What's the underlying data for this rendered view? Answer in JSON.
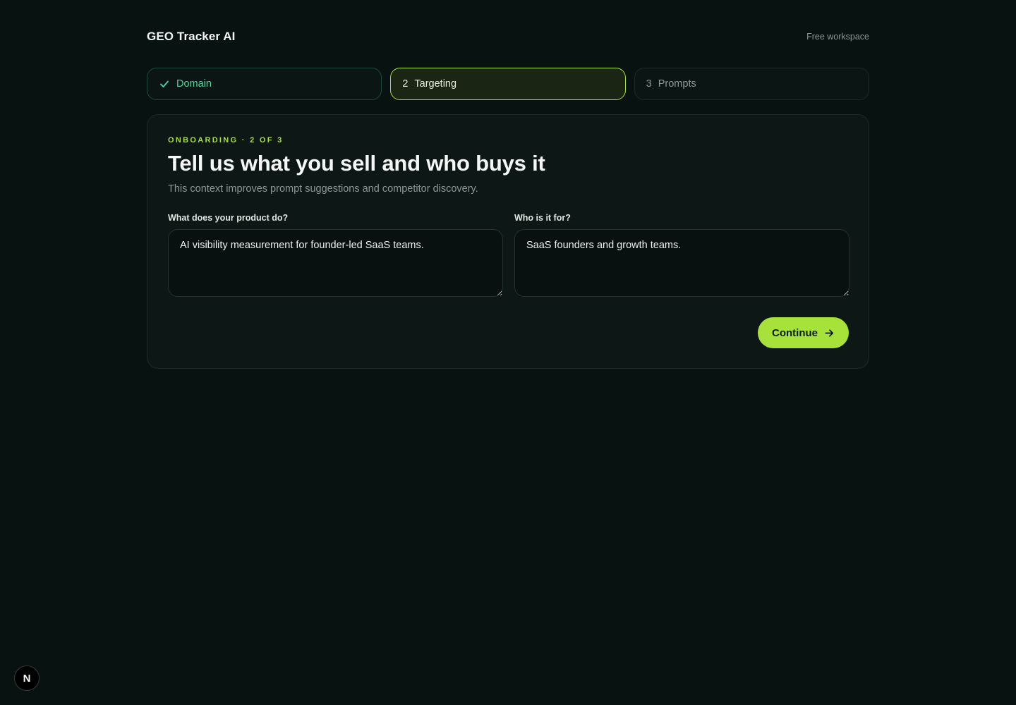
{
  "header": {
    "brand": "GEO Tracker AI",
    "plan": "Free workspace"
  },
  "steps": [
    {
      "number": "",
      "label": "Domain",
      "state": "done",
      "icon": "check-icon"
    },
    {
      "number": "2",
      "label": "Targeting",
      "state": "active"
    },
    {
      "number": "3",
      "label": "Prompts",
      "state": "upcoming"
    }
  ],
  "card": {
    "eyebrow": "ONBOARDING · 2 OF 3",
    "title": "Tell us what you sell and who buys it",
    "subtitle": "This context improves prompt suggestions and competitor discovery.",
    "product_field": {
      "label": "What does your product do?",
      "value": "AI visibility measurement for founder-led SaaS teams."
    },
    "audience_field": {
      "label": "Who is it for?",
      "value": "SaaS founders and growth teams."
    },
    "continue_label": "Continue",
    "continue_icon": "arrow-right-icon"
  },
  "dev_badge": {
    "label": "N"
  },
  "colors": {
    "background": "#081210",
    "accent": "#a7e23a",
    "done": "#4fd6a2"
  }
}
